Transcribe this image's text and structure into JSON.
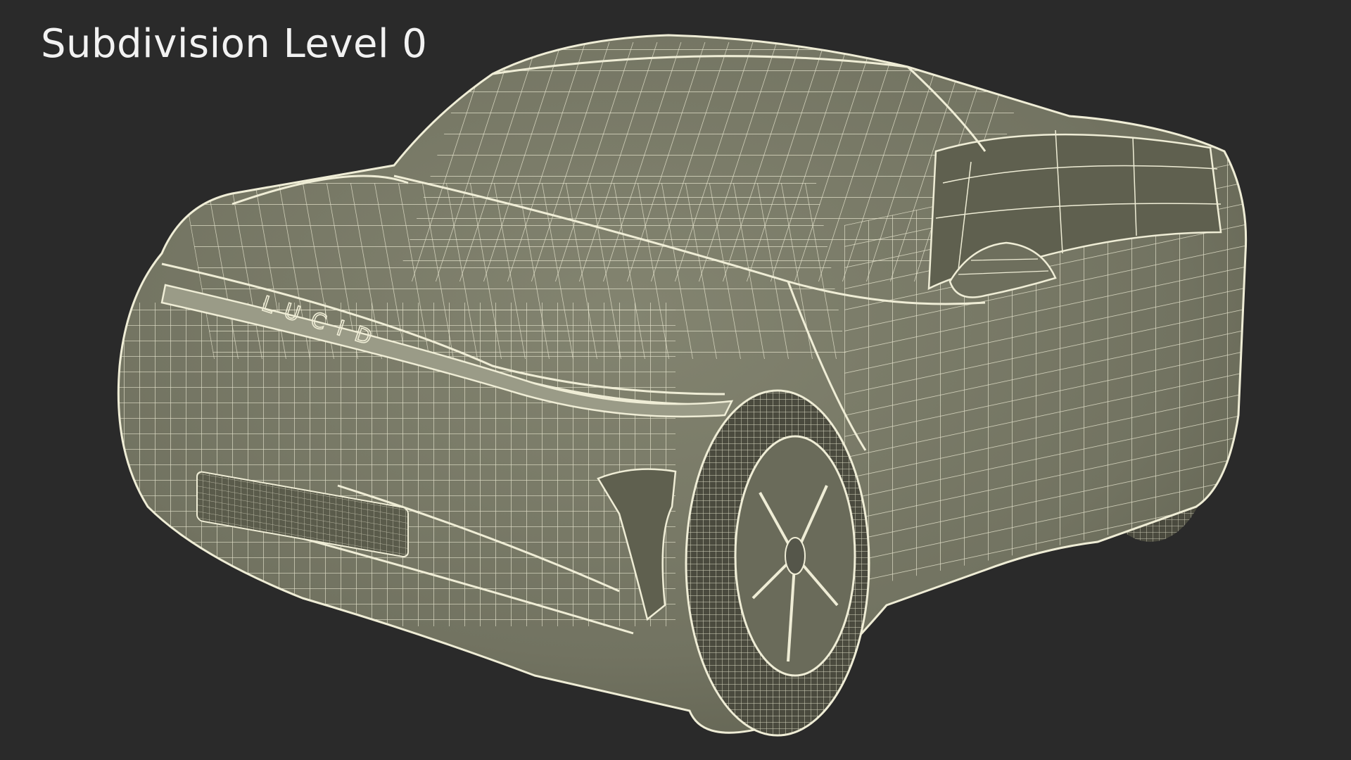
{
  "render": {
    "title": "Subdivision Level 0",
    "logo_text": "LUCID"
  },
  "colors": {
    "background": "#2a2a2a",
    "body": "#7a7b68",
    "body_shadow": "#5f604f",
    "body_dark": "#4a4a3e",
    "wire": "#efedd6",
    "title": "#f2f2f2"
  },
  "subject": {
    "type": "wireframe-car-model",
    "view": "front three-quarter"
  }
}
